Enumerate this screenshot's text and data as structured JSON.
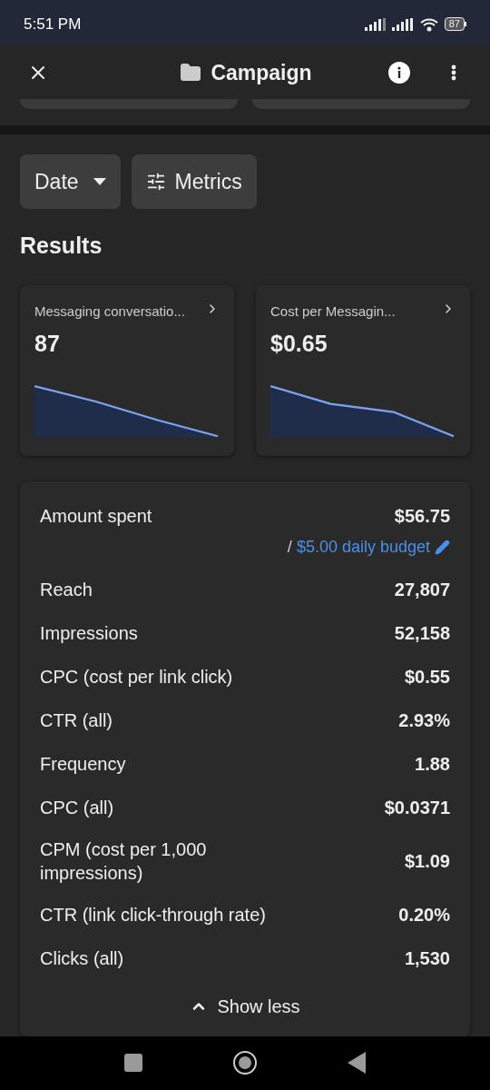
{
  "status_bar": {
    "time": "5:51 PM",
    "battery": "87"
  },
  "header": {
    "title": "Campaign"
  },
  "filters": [
    {
      "kind": "dropdown",
      "label": "Date"
    },
    {
      "kind": "settings",
      "label": "Metrics"
    }
  ],
  "results": {
    "title": "Results",
    "cards": [
      {
        "label": "Messaging conversatio...",
        "value": "87"
      },
      {
        "label": "Cost per Messagin...",
        "value": "$0.65"
      }
    ]
  },
  "metrics": {
    "rows": [
      {
        "label": "Amount spent",
        "value": "$56.75",
        "budget_prefix": "/",
        "budget_link": "$5.00 daily budget"
      },
      {
        "label": "Reach",
        "value": "27,807"
      },
      {
        "label": "Impressions",
        "value": "52,158"
      },
      {
        "label": "CPC (cost per link click)",
        "value": "$0.55"
      },
      {
        "label": "CTR (all)",
        "value": "2.93%"
      },
      {
        "label": "Frequency",
        "value": "1.88"
      },
      {
        "label": "CPC (all)",
        "value": "$0.0371"
      },
      {
        "label": "CPM (cost per 1,000 impressions)",
        "value": "$1.09"
      },
      {
        "label": "CTR (link click-through rate)",
        "value": "0.20%"
      },
      {
        "label": "Clicks (all)",
        "value": "1,530"
      }
    ],
    "toggle": {
      "label": "Show less",
      "expanded": true
    }
  }
}
